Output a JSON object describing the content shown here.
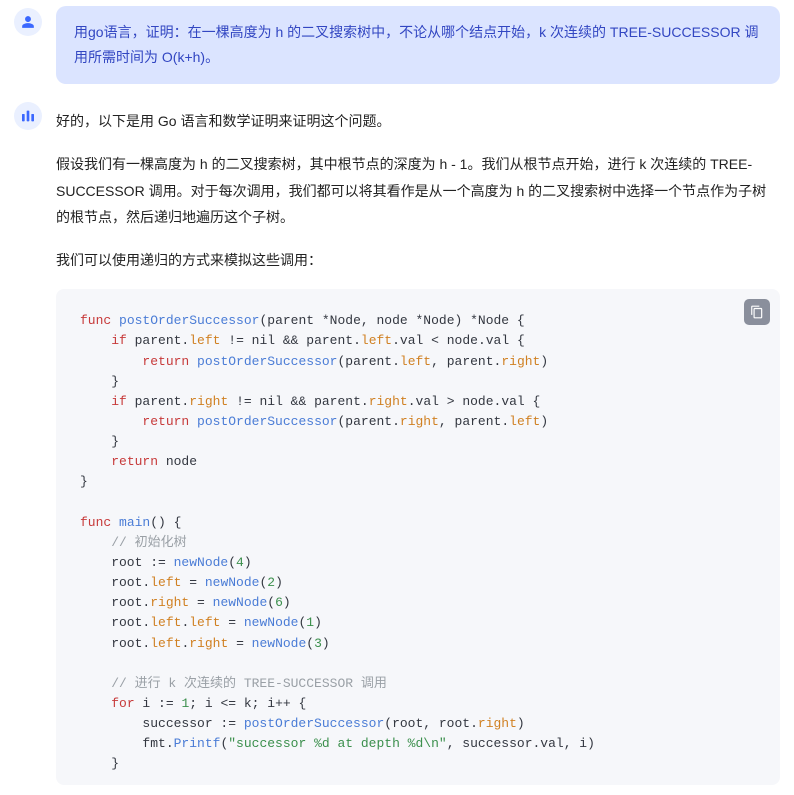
{
  "user_msg": "用go语言，证明：在一棵高度为 h 的二叉搜索树中，不论从哪个结点开始，k 次连续的 TREE-SUCCESSOR 调用所需时间为 O(k+h)。",
  "bot": {
    "p1": "好的，以下是用 Go 语言和数学证明来证明这个问题。",
    "p2": "假设我们有一棵高度为 h 的二叉搜索树，其中根节点的深度为 h - 1。我们从根节点开始，进行 k 次连续的 TREE-SUCCESSOR 调用。对于每次调用，我们都可以将其看作是从一个高度为 h 的二叉搜索树中选择一个节点作为子树的根节点，然后递归地遍历这个子树。",
    "p3": "我们可以使用递归的方式来模拟这些调用："
  },
  "code": {
    "l1_kw": "func",
    "l1_fn": "postOrderSuccessor",
    "l1_rest": "(parent *Node, node *Node) *Node {",
    "l2_kw": "if",
    "l2_a": " parent.",
    "l2_left": "left",
    "l2_b": " != nil && parent.",
    "l2_left2": "left",
    "l2_c": ".val < node.val {",
    "l3_kw": "return",
    "l3_sp": " ",
    "l3_fn": "postOrderSuccessor",
    "l3_a": "(parent.",
    "l3_left": "left",
    "l3_b": ", parent.",
    "l3_right": "right",
    "l3_c": ")",
    "l4": "    }",
    "l5_kw": "if",
    "l5_a": " parent.",
    "l5_right": "right",
    "l5_b": " != nil && parent.",
    "l5_right2": "right",
    "l5_c": ".val > node.val {",
    "l6_kw": "return",
    "l6_sp": " ",
    "l6_fn": "postOrderSuccessor",
    "l6_a": "(parent.",
    "l6_right": "right",
    "l6_b": ", parent.",
    "l6_left": "left",
    "l6_c": ")",
    "l7": "    }",
    "l8_kw": "return",
    "l8_rest": " node",
    "l9": "}",
    "m1_kw": "func",
    "m1_fn": "main",
    "m1_rest": "() {",
    "m2_cmt": "// 初始化树",
    "m3_a": "    root := ",
    "m3_fn": "newNode",
    "m3_b": "(",
    "m3_num": "4",
    "m3_c": ")",
    "m4_a": "    root.",
    "m4_left": "left",
    "m4_b": " = ",
    "m4_fn": "newNode",
    "m4_c": "(",
    "m4_num": "2",
    "m4_d": ")",
    "m5_a": "    root.",
    "m5_right": "right",
    "m5_b": " = ",
    "m5_fn": "newNode",
    "m5_c": "(",
    "m5_num": "6",
    "m5_d": ")",
    "m6_a": "    root.",
    "m6_left": "left",
    "m6_b": ".",
    "m6_left2": "left",
    "m6_c": " = ",
    "m6_fn": "newNode",
    "m6_d": "(",
    "m6_num": "1",
    "m6_e": ")",
    "m7_a": "    root.",
    "m7_left": "left",
    "m7_b": ".",
    "m7_right": "right",
    "m7_c": " = ",
    "m7_fn": "newNode",
    "m7_d": "(",
    "m7_num": "3",
    "m7_e": ")",
    "c1_cmt": "// 进行 k 次连续的 TREE-SUCCESSOR 调用",
    "c2_kw": "for",
    "c2_a": " i := ",
    "c2_n1": "1",
    "c2_b": "; i <= k; i++ {",
    "c3_a": "        successor := ",
    "c3_fn": "postOrderSuccessor",
    "c3_b": "(root, root.",
    "c3_right": "right",
    "c3_c": ")",
    "c4_a": "        fmt.",
    "c4_fn": "Printf",
    "c4_b": "(",
    "c4_str": "\"successor %d at depth %d\\n\"",
    "c4_c": ", successor.val, i)",
    "c5": "    }"
  }
}
